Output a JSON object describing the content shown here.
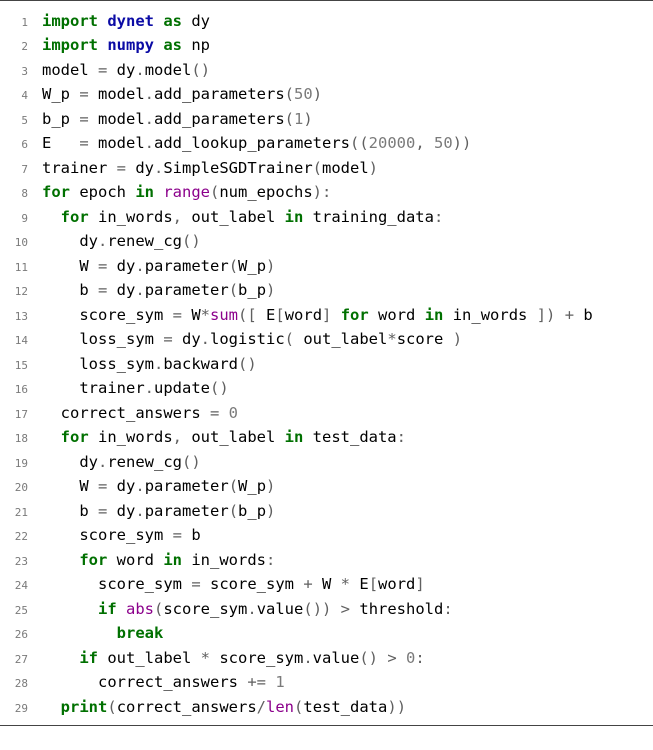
{
  "lines": [
    {
      "n": "1",
      "indent": 0,
      "tokens": [
        {
          "t": "import ",
          "c": "kw"
        },
        {
          "t": "dynet ",
          "c": "mod"
        },
        {
          "t": "as ",
          "c": "kw"
        },
        {
          "t": "dy",
          "c": ""
        }
      ]
    },
    {
      "n": "2",
      "indent": 0,
      "tokens": [
        {
          "t": "import ",
          "c": "kw"
        },
        {
          "t": "numpy ",
          "c": "mod"
        },
        {
          "t": "as ",
          "c": "kw"
        },
        {
          "t": "np",
          "c": ""
        }
      ]
    },
    {
      "n": "3",
      "indent": 0,
      "tokens": [
        {
          "t": "model ",
          "c": ""
        },
        {
          "t": "= ",
          "c": "op"
        },
        {
          "t": "dy",
          "c": ""
        },
        {
          "t": ".",
          "c": "op"
        },
        {
          "t": "model",
          "c": ""
        },
        {
          "t": "()",
          "c": "op"
        }
      ]
    },
    {
      "n": "4",
      "indent": 0,
      "tokens": [
        {
          "t": "W_p ",
          "c": ""
        },
        {
          "t": "= ",
          "c": "op"
        },
        {
          "t": "model",
          "c": ""
        },
        {
          "t": ".",
          "c": "op"
        },
        {
          "t": "add_parameters",
          "c": ""
        },
        {
          "t": "(",
          "c": "op"
        },
        {
          "t": "50",
          "c": "num"
        },
        {
          "t": ")",
          "c": "op"
        }
      ]
    },
    {
      "n": "5",
      "indent": 0,
      "tokens": [
        {
          "t": "b_p ",
          "c": ""
        },
        {
          "t": "= ",
          "c": "op"
        },
        {
          "t": "model",
          "c": ""
        },
        {
          "t": ".",
          "c": "op"
        },
        {
          "t": "add_parameters",
          "c": ""
        },
        {
          "t": "(",
          "c": "op"
        },
        {
          "t": "1",
          "c": "num"
        },
        {
          "t": ")",
          "c": "op"
        }
      ]
    },
    {
      "n": "6",
      "indent": 0,
      "tokens": [
        {
          "t": "E   ",
          "c": ""
        },
        {
          "t": "= ",
          "c": "op"
        },
        {
          "t": "model",
          "c": ""
        },
        {
          "t": ".",
          "c": "op"
        },
        {
          "t": "add_lookup_parameters",
          "c": ""
        },
        {
          "t": "((",
          "c": "op"
        },
        {
          "t": "20000",
          "c": "num"
        },
        {
          "t": ", ",
          "c": "op"
        },
        {
          "t": "50",
          "c": "num"
        },
        {
          "t": "))",
          "c": "op"
        }
      ]
    },
    {
      "n": "7",
      "indent": 0,
      "tokens": [
        {
          "t": "trainer ",
          "c": ""
        },
        {
          "t": "= ",
          "c": "op"
        },
        {
          "t": "dy",
          "c": ""
        },
        {
          "t": ".",
          "c": "op"
        },
        {
          "t": "SimpleSGDTrainer",
          "c": ""
        },
        {
          "t": "(",
          "c": "op"
        },
        {
          "t": "model",
          "c": ""
        },
        {
          "t": ")",
          "c": "op"
        }
      ]
    },
    {
      "n": "8",
      "indent": 0,
      "tokens": [
        {
          "t": "for ",
          "c": "kw"
        },
        {
          "t": "epoch ",
          "c": ""
        },
        {
          "t": "in ",
          "c": "kw"
        },
        {
          "t": "range",
          "c": "fn"
        },
        {
          "t": "(",
          "c": "op"
        },
        {
          "t": "num_epochs",
          "c": ""
        },
        {
          "t": "):",
          "c": "op"
        }
      ]
    },
    {
      "n": "9",
      "indent": 1,
      "tokens": [
        {
          "t": "for ",
          "c": "kw"
        },
        {
          "t": "in_words",
          "c": ""
        },
        {
          "t": ", ",
          "c": "op"
        },
        {
          "t": "out_label ",
          "c": ""
        },
        {
          "t": "in ",
          "c": "kw"
        },
        {
          "t": "training_data",
          "c": ""
        },
        {
          "t": ":",
          "c": "op"
        }
      ]
    },
    {
      "n": "10",
      "indent": 2,
      "tokens": [
        {
          "t": "dy",
          "c": ""
        },
        {
          "t": ".",
          "c": "op"
        },
        {
          "t": "renew_cg",
          "c": ""
        },
        {
          "t": "()",
          "c": "op"
        }
      ]
    },
    {
      "n": "11",
      "indent": 2,
      "tokens": [
        {
          "t": "W ",
          "c": ""
        },
        {
          "t": "= ",
          "c": "op"
        },
        {
          "t": "dy",
          "c": ""
        },
        {
          "t": ".",
          "c": "op"
        },
        {
          "t": "parameter",
          "c": ""
        },
        {
          "t": "(",
          "c": "op"
        },
        {
          "t": "W_p",
          "c": ""
        },
        {
          "t": ")",
          "c": "op"
        }
      ]
    },
    {
      "n": "12",
      "indent": 2,
      "tokens": [
        {
          "t": "b ",
          "c": ""
        },
        {
          "t": "= ",
          "c": "op"
        },
        {
          "t": "dy",
          "c": ""
        },
        {
          "t": ".",
          "c": "op"
        },
        {
          "t": "parameter",
          "c": ""
        },
        {
          "t": "(",
          "c": "op"
        },
        {
          "t": "b_p",
          "c": ""
        },
        {
          "t": ")",
          "c": "op"
        }
      ]
    },
    {
      "n": "13",
      "indent": 2,
      "tokens": [
        {
          "t": "score_sym ",
          "c": ""
        },
        {
          "t": "= ",
          "c": "op"
        },
        {
          "t": "W",
          "c": ""
        },
        {
          "t": "*",
          "c": "op"
        },
        {
          "t": "sum",
          "c": "fn"
        },
        {
          "t": "([ ",
          "c": "op"
        },
        {
          "t": "E",
          "c": ""
        },
        {
          "t": "[",
          "c": "op"
        },
        {
          "t": "word",
          "c": ""
        },
        {
          "t": "] ",
          "c": "op"
        },
        {
          "t": "for ",
          "c": "kw"
        },
        {
          "t": "word ",
          "c": ""
        },
        {
          "t": "in ",
          "c": "kw"
        },
        {
          "t": "in_words ",
          "c": ""
        },
        {
          "t": "]) + ",
          "c": "op"
        },
        {
          "t": "b",
          "c": ""
        }
      ]
    },
    {
      "n": "14",
      "indent": 2,
      "tokens": [
        {
          "t": "loss_sym ",
          "c": ""
        },
        {
          "t": "= ",
          "c": "op"
        },
        {
          "t": "dy",
          "c": ""
        },
        {
          "t": ".",
          "c": "op"
        },
        {
          "t": "logistic",
          "c": ""
        },
        {
          "t": "( ",
          "c": "op"
        },
        {
          "t": "out_label",
          "c": ""
        },
        {
          "t": "*",
          "c": "op"
        },
        {
          "t": "score ",
          "c": ""
        },
        {
          "t": ")",
          "c": "op"
        }
      ]
    },
    {
      "n": "15",
      "indent": 2,
      "tokens": [
        {
          "t": "loss_sym",
          "c": ""
        },
        {
          "t": ".",
          "c": "op"
        },
        {
          "t": "backward",
          "c": ""
        },
        {
          "t": "()",
          "c": "op"
        }
      ]
    },
    {
      "n": "16",
      "indent": 2,
      "tokens": [
        {
          "t": "trainer",
          "c": ""
        },
        {
          "t": ".",
          "c": "op"
        },
        {
          "t": "update",
          "c": ""
        },
        {
          "t": "()",
          "c": "op"
        }
      ]
    },
    {
      "n": "17",
      "indent": 1,
      "tokens": [
        {
          "t": "correct_answers ",
          "c": ""
        },
        {
          "t": "= ",
          "c": "op"
        },
        {
          "t": "0",
          "c": "num"
        }
      ]
    },
    {
      "n": "18",
      "indent": 1,
      "tokens": [
        {
          "t": "for ",
          "c": "kw"
        },
        {
          "t": "in_words",
          "c": ""
        },
        {
          "t": ", ",
          "c": "op"
        },
        {
          "t": "out_label ",
          "c": ""
        },
        {
          "t": "in ",
          "c": "kw"
        },
        {
          "t": "test_data",
          "c": ""
        },
        {
          "t": ":",
          "c": "op"
        }
      ]
    },
    {
      "n": "19",
      "indent": 2,
      "tokens": [
        {
          "t": "dy",
          "c": ""
        },
        {
          "t": ".",
          "c": "op"
        },
        {
          "t": "renew_cg",
          "c": ""
        },
        {
          "t": "()",
          "c": "op"
        }
      ]
    },
    {
      "n": "20",
      "indent": 2,
      "tokens": [
        {
          "t": "W ",
          "c": ""
        },
        {
          "t": "= ",
          "c": "op"
        },
        {
          "t": "dy",
          "c": ""
        },
        {
          "t": ".",
          "c": "op"
        },
        {
          "t": "parameter",
          "c": ""
        },
        {
          "t": "(",
          "c": "op"
        },
        {
          "t": "W_p",
          "c": ""
        },
        {
          "t": ")",
          "c": "op"
        }
      ]
    },
    {
      "n": "21",
      "indent": 2,
      "tokens": [
        {
          "t": "b ",
          "c": ""
        },
        {
          "t": "= ",
          "c": "op"
        },
        {
          "t": "dy",
          "c": ""
        },
        {
          "t": ".",
          "c": "op"
        },
        {
          "t": "parameter",
          "c": ""
        },
        {
          "t": "(",
          "c": "op"
        },
        {
          "t": "b_p",
          "c": ""
        },
        {
          "t": ")",
          "c": "op"
        }
      ]
    },
    {
      "n": "22",
      "indent": 2,
      "tokens": [
        {
          "t": "score_sym ",
          "c": ""
        },
        {
          "t": "= ",
          "c": "op"
        },
        {
          "t": "b",
          "c": ""
        }
      ]
    },
    {
      "n": "23",
      "indent": 2,
      "tokens": [
        {
          "t": "for ",
          "c": "kw"
        },
        {
          "t": "word ",
          "c": ""
        },
        {
          "t": "in ",
          "c": "kw"
        },
        {
          "t": "in_words",
          "c": ""
        },
        {
          "t": ":",
          "c": "op"
        }
      ]
    },
    {
      "n": "24",
      "indent": 3,
      "tokens": [
        {
          "t": "score_sym ",
          "c": ""
        },
        {
          "t": "= ",
          "c": "op"
        },
        {
          "t": "score_sym ",
          "c": ""
        },
        {
          "t": "+ ",
          "c": "op"
        },
        {
          "t": "W ",
          "c": ""
        },
        {
          "t": "* ",
          "c": "op"
        },
        {
          "t": "E",
          "c": ""
        },
        {
          "t": "[",
          "c": "op"
        },
        {
          "t": "word",
          "c": ""
        },
        {
          "t": "]",
          "c": "op"
        }
      ]
    },
    {
      "n": "25",
      "indent": 3,
      "tokens": [
        {
          "t": "if ",
          "c": "kw"
        },
        {
          "t": "abs",
          "c": "fn"
        },
        {
          "t": "(",
          "c": "op"
        },
        {
          "t": "score_sym",
          "c": ""
        },
        {
          "t": ".",
          "c": "op"
        },
        {
          "t": "value",
          "c": ""
        },
        {
          "t": "()) > ",
          "c": "op"
        },
        {
          "t": "threshold",
          "c": ""
        },
        {
          "t": ":",
          "c": "op"
        }
      ]
    },
    {
      "n": "26",
      "indent": 4,
      "tokens": [
        {
          "t": "break",
          "c": "kw"
        }
      ]
    },
    {
      "n": "27",
      "indent": 2,
      "tokens": [
        {
          "t": "if ",
          "c": "kw"
        },
        {
          "t": "out_label ",
          "c": ""
        },
        {
          "t": "* ",
          "c": "op"
        },
        {
          "t": "score_sym",
          "c": ""
        },
        {
          "t": ".",
          "c": "op"
        },
        {
          "t": "value",
          "c": ""
        },
        {
          "t": "() > ",
          "c": "op"
        },
        {
          "t": "0",
          "c": "num"
        },
        {
          "t": ":",
          "c": "op"
        }
      ]
    },
    {
      "n": "28",
      "indent": 3,
      "tokens": [
        {
          "t": "correct_answers ",
          "c": ""
        },
        {
          "t": "+= ",
          "c": "op"
        },
        {
          "t": "1",
          "c": "num"
        }
      ]
    },
    {
      "n": "29",
      "indent": 1,
      "tokens": [
        {
          "t": "print",
          "c": "kw"
        },
        {
          "t": "(",
          "c": "op"
        },
        {
          "t": "correct_answers",
          "c": ""
        },
        {
          "t": "/",
          "c": "op"
        },
        {
          "t": "len",
          "c": "fn"
        },
        {
          "t": "(",
          "c": "op"
        },
        {
          "t": "test_data",
          "c": ""
        },
        {
          "t": "))",
          "c": "op"
        }
      ]
    }
  ],
  "indent_unit": "  "
}
